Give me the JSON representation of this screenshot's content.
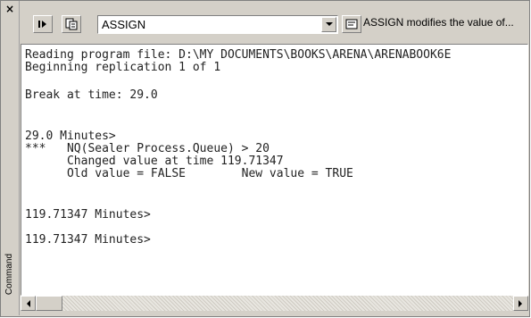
{
  "side_panel": {
    "label": "Command",
    "close_icon": "close-icon"
  },
  "toolbar": {
    "run_icon": "step-run-icon",
    "module_icon": "module-view-icon",
    "command_value": "ASSIGN",
    "dropdown_icon": "chevron-down-icon",
    "options_icon": "dialog-icon",
    "command_hint": "ASSIGN modifies the value of..."
  },
  "console": {
    "lines": [
      "Reading program file: D:\\MY DOCUMENTS\\BOOKS\\ARENA\\ARENABOOK6E",
      "Beginning replication 1 of 1",
      "Break at time: 29.0",
      "29.0 Minutes>",
      "***   NQ(Sealer Process.Queue) > 20",
      "      Changed value at time 119.71347",
      "      Old value = FALSE        New value = TRUE",
      "119.71347 Minutes>",
      "119.71347 Minutes>"
    ]
  }
}
